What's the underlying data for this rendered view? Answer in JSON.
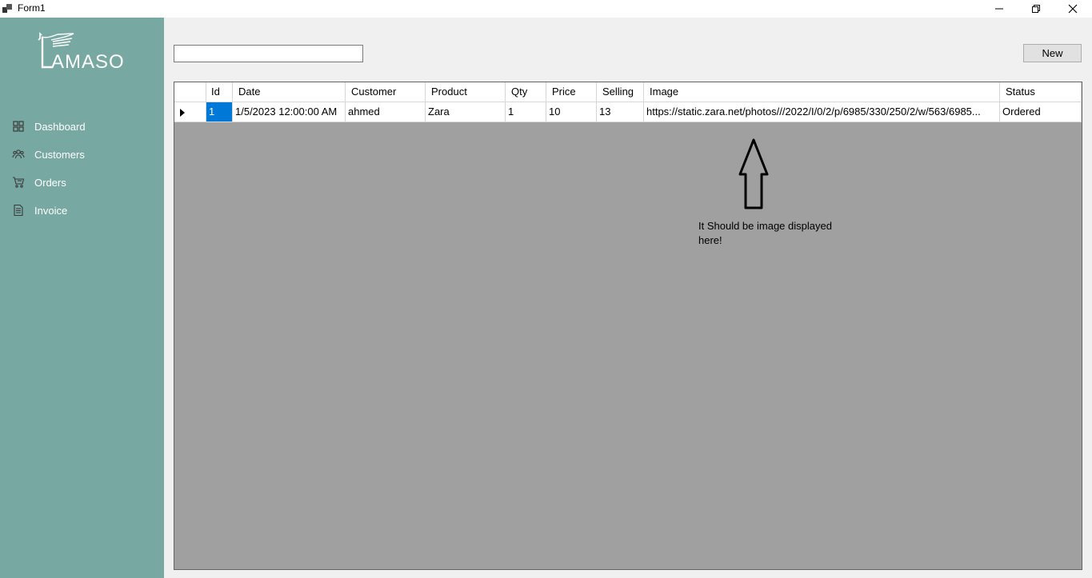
{
  "window": {
    "title": "Form1"
  },
  "sidebar": {
    "logo_text": "AMASO",
    "items": [
      {
        "label": "Dashboard",
        "icon": "dashboard-icon"
      },
      {
        "label": "Customers",
        "icon": "customers-icon"
      },
      {
        "label": "Orders",
        "icon": "orders-icon"
      },
      {
        "label": "Invoice",
        "icon": "invoice-icon"
      }
    ]
  },
  "toolbar": {
    "search_value": "",
    "new_label": "New"
  },
  "grid": {
    "columns": [
      "Id",
      "Date",
      "Customer",
      "Product",
      "Qty",
      "Price",
      "Selling",
      "Image",
      "Status"
    ],
    "rows": [
      [
        "1",
        "1/5/2023 12:00:00 AM",
        "ahmed",
        "Zara",
        "1",
        "10",
        "13",
        "https://static.zara.net/photos///2022/I/0/2/p/6985/330/250/2/w/563/6985...",
        "Ordered"
      ]
    ]
  },
  "annotation": {
    "line1": "It Should be image displayed",
    "line2": "here!"
  }
}
